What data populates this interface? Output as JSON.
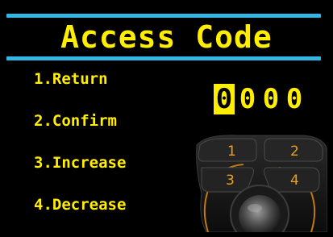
{
  "screen": {
    "title": "Access Code",
    "accent_color": "#ffee00",
    "bar_color": "#2fb8e6"
  },
  "menu": {
    "items": [
      {
        "label": "1.Return"
      },
      {
        "label": "2.Confirm"
      },
      {
        "label": "3.Increase"
      },
      {
        "label": "4.Decrease"
      }
    ]
  },
  "code": {
    "digits": [
      "0",
      "0",
      "0",
      "0"
    ],
    "selected_index": 0
  },
  "keypad": {
    "keys": [
      "1",
      "2",
      "3",
      "4"
    ],
    "key_color": "#e8a020",
    "icon": "joystick-keypad-icon"
  }
}
